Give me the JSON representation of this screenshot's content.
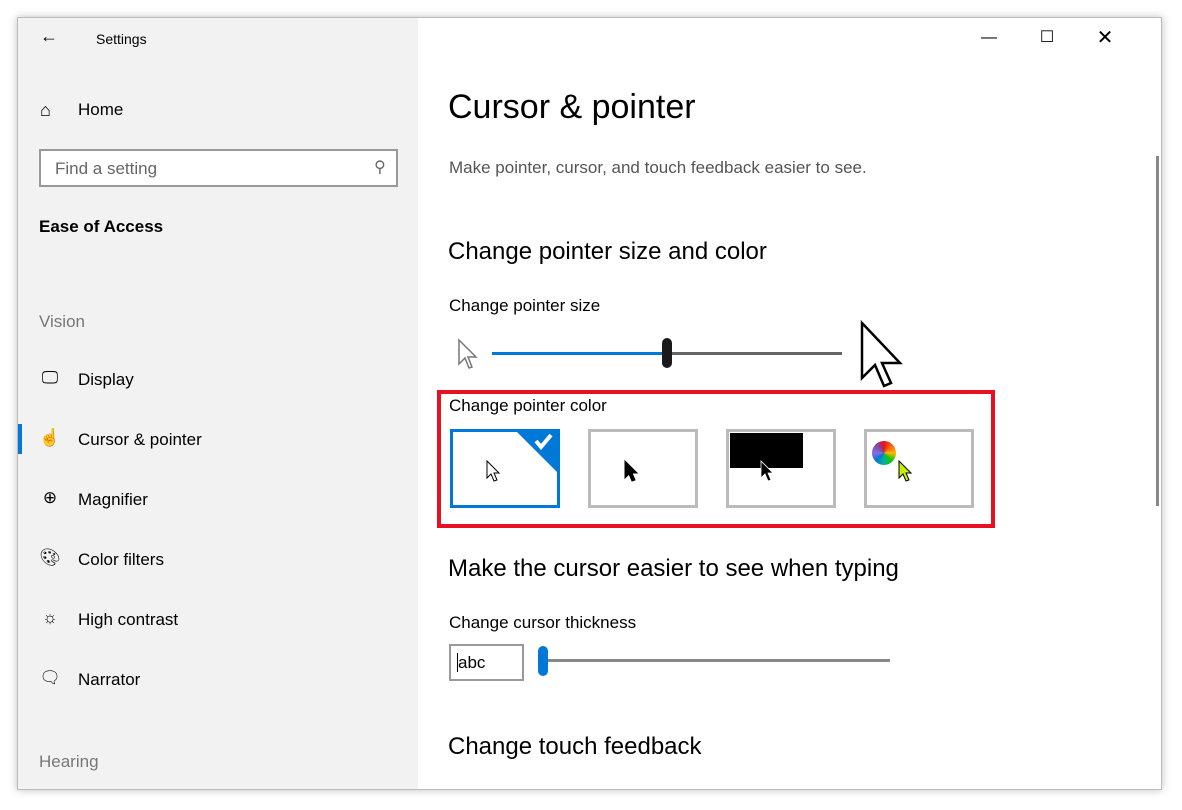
{
  "window": {
    "title": "Settings",
    "back_icon": "arrow-left-icon",
    "controls": [
      "minimize",
      "maximize",
      "close"
    ]
  },
  "sidebar": {
    "home": "Home",
    "search": {
      "placeholder": "Find a setting",
      "icon": "search-icon"
    },
    "category": "Ease of Access",
    "groups": {
      "vision": "Vision",
      "hearing": "Hearing"
    },
    "items": [
      {
        "label": "Display",
        "icon": "monitor-icon"
      },
      {
        "label": "Cursor & pointer",
        "icon": "cursor-hand-icon",
        "selected": true
      },
      {
        "label": "Magnifier",
        "icon": "magnifier-icon"
      },
      {
        "label": "Color filters",
        "icon": "palette-icon"
      },
      {
        "label": "High contrast",
        "icon": "sun-icon"
      },
      {
        "label": "Narrator",
        "icon": "narrator-icon"
      }
    ]
  },
  "main": {
    "title": "Cursor & pointer",
    "description": "Make pointer, cursor, and touch feedback easier to see.",
    "section1": "Change pointer size and color",
    "pointer_size_label": "Change pointer size",
    "pointer_size_fraction": 0.5,
    "pointer_color_label": "Change pointer color",
    "pointer_color_options": [
      "white",
      "black",
      "inverted",
      "custom"
    ],
    "pointer_color_selected": "white",
    "accent": "#0078d7",
    "highlight_color": "#e81123",
    "section2": "Make the cursor easier to see when typing",
    "thickness_label": "Change cursor thickness",
    "thickness_preview": "abc",
    "thickness_fraction": 0,
    "section3": "Change touch feedback"
  }
}
